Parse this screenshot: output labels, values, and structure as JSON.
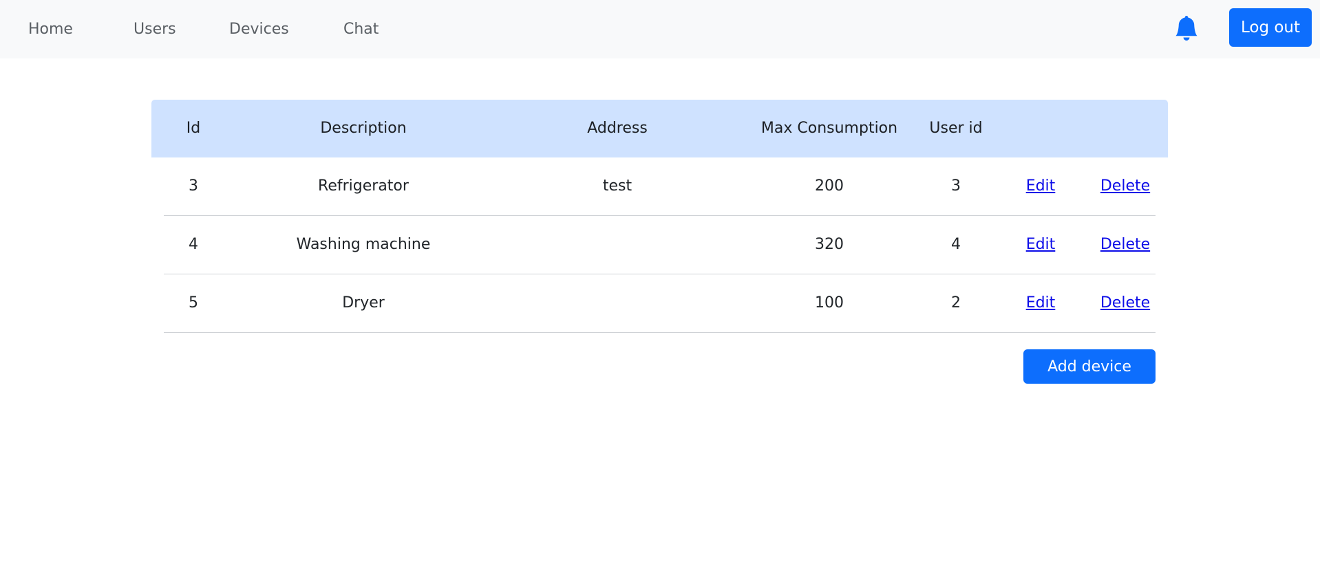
{
  "nav": {
    "items": [
      "Home",
      "Users",
      "Devices",
      "Chat"
    ],
    "logout_label": "Log out",
    "bell_icon": "bell-icon"
  },
  "table": {
    "headers": [
      "Id",
      "Description",
      "Address",
      "Max Consumption",
      "User id"
    ],
    "rows": [
      {
        "id": "3",
        "description": "Refrigerator",
        "address": "test",
        "max_consumption": "200",
        "user_id": "3",
        "edit": "Edit",
        "delete": "Delete"
      },
      {
        "id": "4",
        "description": "Washing machine",
        "address": "",
        "max_consumption": "320",
        "user_id": "4",
        "edit": "Edit",
        "delete": "Delete"
      },
      {
        "id": "5",
        "description": "Dryer",
        "address": "",
        "max_consumption": "100",
        "user_id": "2",
        "edit": "Edit",
        "delete": "Delete"
      }
    ]
  },
  "add_device_label": "Add device",
  "colors": {
    "primary": "#0d6efd",
    "header_bg": "#cfe2ff",
    "navbar_bg": "#f8f9fa",
    "link": "#0d0de8"
  }
}
